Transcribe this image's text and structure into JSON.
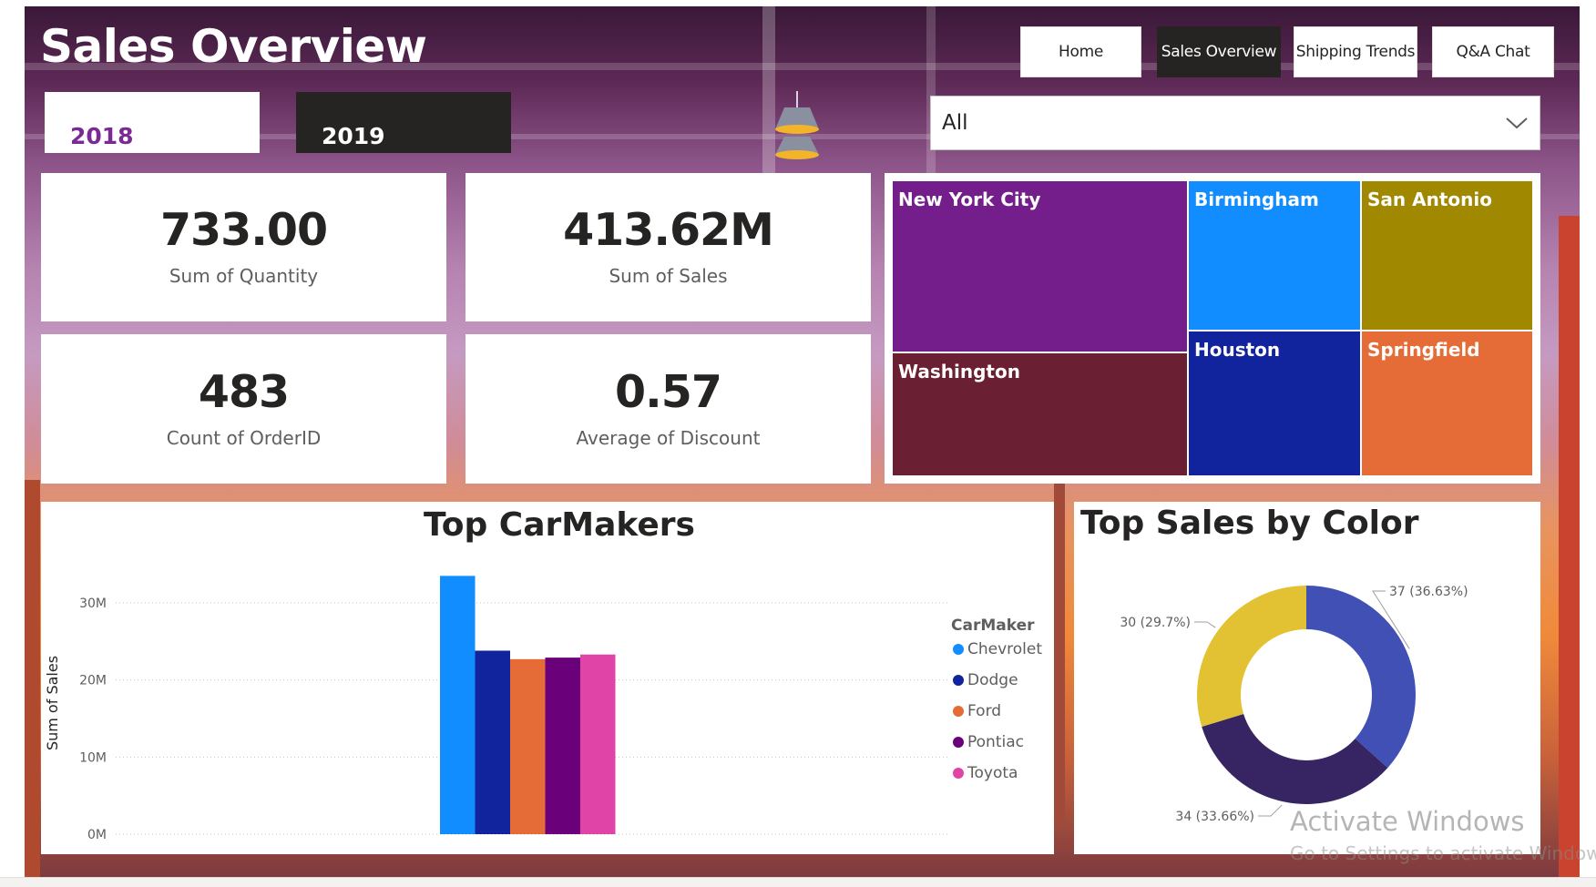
{
  "header": {
    "title": "Sales Overview"
  },
  "nav": {
    "home": "Home",
    "sales_overview": "Sales Overview",
    "shipping_trends": "Shipping Trends",
    "qa_chat": "Q&A Chat"
  },
  "year_toggle": {
    "y2018": "2018",
    "y2019": "2019"
  },
  "slicer": {
    "value": "All"
  },
  "kpis": {
    "quantity": {
      "value": "733.00",
      "label": "Sum of Quantity"
    },
    "sales": {
      "value": "413.62M",
      "label": "Sum of Sales"
    },
    "orders": {
      "value": "483",
      "label": "Count of OrderID"
    },
    "discount": {
      "value": "0.57",
      "label": "Average of Discount"
    }
  },
  "treemap": {
    "tiles": [
      {
        "label": "New York City",
        "color": "#741e8c"
      },
      {
        "label": "Washington",
        "color": "#6b1f32"
      },
      {
        "label": "Birmingham",
        "color": "#118dff"
      },
      {
        "label": "Houston",
        "color": "#12239e"
      },
      {
        "label": "San Antonio",
        "color": "#a08800"
      },
      {
        "label": "Springfield",
        "color": "#e66c37"
      }
    ]
  },
  "chart_data": [
    {
      "type": "bar",
      "title": "Top CarMakers",
      "ylabel": "Sum of Sales",
      "legend_title": "CarMaker",
      "legend_position": "right",
      "grid": true,
      "ylim": [
        0,
        30000000
      ],
      "yticks": [
        "0M",
        "10M",
        "20M",
        "30M"
      ],
      "ytick_values": [
        0,
        10000000,
        20000000,
        30000000
      ],
      "series": [
        {
          "name": "Chevrolet",
          "value": 33500000,
          "color": "#118dff"
        },
        {
          "name": "Dodge",
          "value": 23800000,
          "color": "#12239e"
        },
        {
          "name": "Ford",
          "value": 22700000,
          "color": "#e66c37"
        },
        {
          "name": "Pontiac",
          "value": 22900000,
          "color": "#6b007b"
        },
        {
          "name": "Toyota",
          "value": 23300000,
          "color": "#e044a7"
        }
      ]
    },
    {
      "type": "pie",
      "title": "Top Sales by Color",
      "slices": [
        {
          "value": 37,
          "label": "37 (36.63%)",
          "color": "#4050b5"
        },
        {
          "value": 34,
          "label": "34 (33.66%)",
          "color": "#362562"
        },
        {
          "value": 30,
          "label": "30 (29.7%)",
          "color": "#e2c232"
        }
      ]
    }
  ],
  "watermark": {
    "line1": "Activate Windows",
    "line2": "Go to Settings to activate Windows."
  }
}
